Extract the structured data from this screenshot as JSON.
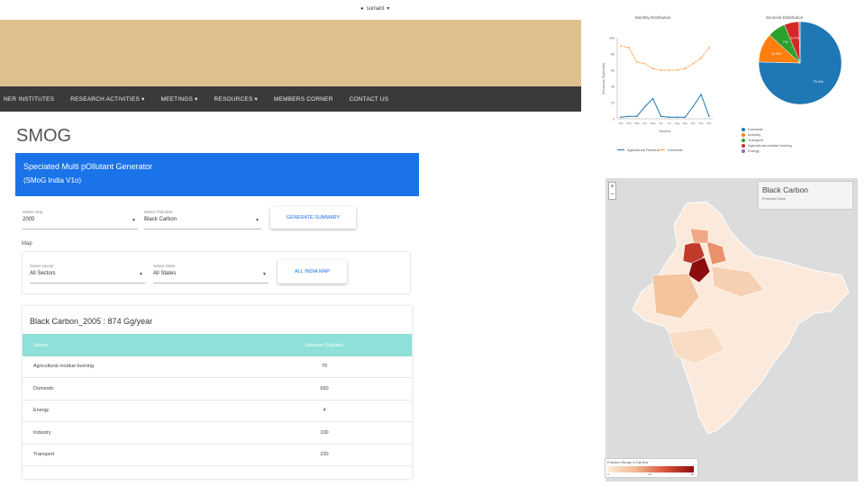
{
  "header": {
    "user": "sumant"
  },
  "nav": [
    "NER INSTITUTES",
    "RESEARCH ACTIVITIES ▾",
    "MEETINGS ▾",
    "RESOURCES ▾",
    "MEMBERS CORNER",
    "CONTACT US"
  ],
  "page": {
    "title": "SMOG"
  },
  "panel": {
    "line1": "Speciated Multi pOllutant Generator",
    "line2": "(SMoG India V1o)"
  },
  "filters": {
    "year_label": "Select Year",
    "year_value": "2005",
    "pollutant_label": "Select Pollutant",
    "pollutant_value": "Black Carbon",
    "generate": "GENERATE SUMMARY",
    "map_label": "Map",
    "sector_label": "Select Sector",
    "sector_value": "All Sectors",
    "state_label": "Select State",
    "state_value": "All States",
    "all_india": "ALL INDIA MAP"
  },
  "summary": {
    "title": "Black Carbon_2005 : 874 Gg/year",
    "col_sector": "Sectors",
    "col_emission": "Emission (Gg/year)",
    "rows": [
      {
        "sector": "Agricultural residue burning",
        "value": "70"
      },
      {
        "sector": "Domestic",
        "value": "660"
      },
      {
        "sector": "Energy",
        "value": "4"
      },
      {
        "sector": "Industry",
        "value": "100"
      },
      {
        "sector": "Transport",
        "value": "230"
      }
    ]
  },
  "line_chart": {
    "title": "Monthly Distribution",
    "xlabel": "Months",
    "ylabel": "Emissions (Gg/month)",
    "months": [
      "Jan",
      "Feb",
      "Mar",
      "Apr",
      "May",
      "Jun",
      "Jul",
      "Aug",
      "Sep",
      "Oct",
      "Nov",
      "Dec"
    ],
    "yticks": [
      "100",
      "80",
      "60",
      "40",
      "20",
      "0"
    ],
    "ymax": 100,
    "series": [
      {
        "name": "Agricultural Residue",
        "color": "#1f77b4",
        "values": [
          2,
          3,
          3,
          15,
          25,
          3,
          2,
          2,
          2,
          15,
          30,
          3
        ]
      },
      {
        "name": "Domestic",
        "color": "#ff9f40",
        "values": [
          90,
          88,
          70,
          68,
          62,
          60,
          60,
          60,
          62,
          68,
          75,
          88
        ]
      }
    ]
  },
  "pie_chart": {
    "title": "Sectorial Distribution",
    "slices": [
      {
        "name": "Domestic",
        "value": 75.4,
        "label": "75.4%",
        "color": "#1f77b4"
      },
      {
        "name": "Industry",
        "value": 11.4,
        "label": "11.4%",
        "color": "#ff7f0e"
      },
      {
        "name": "Transport",
        "value": 7,
        "label": "7%",
        "color": "#2ca02c"
      },
      {
        "name": "Agricultural residue burning",
        "value": 5.7,
        "label": "5.7%",
        "color": "#d62728"
      },
      {
        "name": "Energy",
        "value": 0.5,
        "label": "",
        "color": "#9467bd"
      }
    ]
  },
  "map": {
    "title": "Black Carbon",
    "subtitle": "Emission Data",
    "legend_title": "Pollution Range in Gg/Year",
    "legend_ticks": [
      "0",
      "20",
      "40"
    ]
  }
}
